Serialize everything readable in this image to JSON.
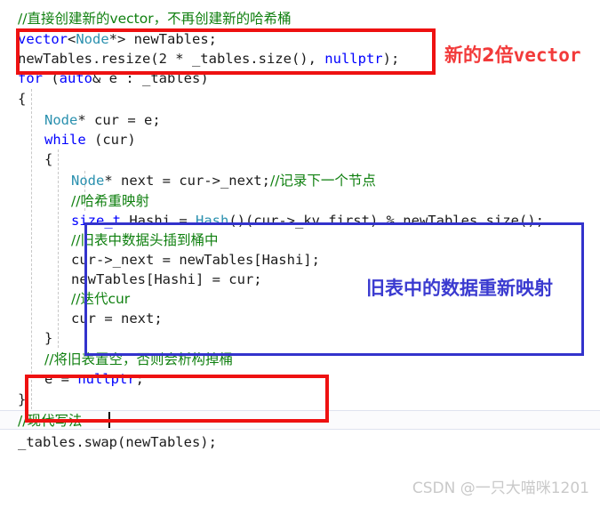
{
  "editor": {
    "language": "cpp",
    "background": "#ffffff",
    "colors": {
      "keyword": "#0000ff",
      "type": "#2b91af",
      "comment": "#108010",
      "plain": "#1b1b1b",
      "indent_guide": "#c8c8c8",
      "current_line_bg": "#fbfbfd"
    },
    "lines": [
      {
        "indent": 0,
        "tokens": [
          {
            "t": "//直接创建新的vector，不再创建新的哈希桶",
            "c": "cmt"
          }
        ]
      },
      {
        "indent": 0,
        "tokens": [
          {
            "t": "vector",
            "c": "kw"
          },
          {
            "t": "<",
            "c": "pln"
          },
          {
            "t": "Node",
            "c": "typ"
          },
          {
            "t": "*> newTables;",
            "c": "pln"
          }
        ]
      },
      {
        "indent": 0,
        "tokens": [
          {
            "t": "newTables.resize(2 * _tables.size(), ",
            "c": "pln"
          },
          {
            "t": "nullptr",
            "c": "kw"
          },
          {
            "t": ");",
            "c": "pln"
          }
        ]
      },
      {
        "indent": 0,
        "tokens": [
          {
            "t": "for",
            "c": "kw"
          },
          {
            "t": " (",
            "c": "pln"
          },
          {
            "t": "auto",
            "c": "kw"
          },
          {
            "t": "& e : _tables)",
            "c": "pln"
          }
        ]
      },
      {
        "indent": 0,
        "tokens": [
          {
            "t": "{",
            "c": "pln"
          }
        ]
      },
      {
        "indent": 1,
        "tokens": [
          {
            "t": "Node",
            "c": "typ"
          },
          {
            "t": "* cur = e;",
            "c": "pln"
          }
        ]
      },
      {
        "indent": 1,
        "tokens": [
          {
            "t": "while",
            "c": "kw"
          },
          {
            "t": " (cur)",
            "c": "pln"
          }
        ]
      },
      {
        "indent": 1,
        "tokens": [
          {
            "t": "{",
            "c": "pln"
          }
        ]
      },
      {
        "indent": 2,
        "tokens": [
          {
            "t": "Node",
            "c": "typ"
          },
          {
            "t": "* next = cur->_next;",
            "c": "pln"
          },
          {
            "t": "//记录下一个节点",
            "c": "cmt"
          }
        ]
      },
      {
        "indent": 2,
        "tokens": [
          {
            "t": "//哈希重映射",
            "c": "cmt"
          }
        ]
      },
      {
        "indent": 2,
        "tokens": [
          {
            "t": "size_t",
            "c": "kw"
          },
          {
            "t": " Hashi = ",
            "c": "pln"
          },
          {
            "t": "Hash",
            "c": "typ"
          },
          {
            "t": "()(cur->_kv.first) % newTables.size();",
            "c": "pln"
          }
        ]
      },
      {
        "indent": 2,
        "tokens": [
          {
            "t": "//旧表中数据头插到桶中",
            "c": "cmt"
          }
        ]
      },
      {
        "indent": 2,
        "tokens": [
          {
            "t": "cur->_next = newTables[Hashi];",
            "c": "pln"
          }
        ]
      },
      {
        "indent": 2,
        "tokens": [
          {
            "t": "newTables[Hashi] = cur;",
            "c": "pln"
          }
        ]
      },
      {
        "indent": 2,
        "tokens": [
          {
            "t": "//迭代cur",
            "c": "cmt"
          }
        ]
      },
      {
        "indent": 2,
        "tokens": [
          {
            "t": "cur = next;",
            "c": "pln"
          }
        ]
      },
      {
        "indent": 1,
        "tokens": [
          {
            "t": "}",
            "c": "pln"
          }
        ]
      },
      {
        "indent": 1,
        "tokens": [
          {
            "t": "//将旧表置空，否则会析构掉桶",
            "c": "cmt"
          }
        ]
      },
      {
        "indent": 1,
        "tokens": [
          {
            "t": "e = ",
            "c": "pln"
          },
          {
            "t": "nullptr",
            "c": "kw"
          },
          {
            "t": ";",
            "c": "pln"
          }
        ]
      },
      {
        "indent": 0,
        "tokens": [
          {
            "t": "}",
            "c": "pln"
          }
        ]
      },
      {
        "indent": 0,
        "tokens": [
          {
            "t": "//现代写法",
            "c": "cmt"
          }
        ]
      },
      {
        "indent": 0,
        "tokens": [
          {
            "t": "_tables.swap(newTables);",
            "c": "pln"
          }
        ]
      }
    ],
    "current_line_index": 20
  },
  "annotations": [
    {
      "id": "annotation-new-double-vector",
      "text": "新的2倍vector",
      "text_cjk": "新的2倍",
      "text_mono": "vector",
      "color": "#f23a3a",
      "kind": "red"
    },
    {
      "id": "annotation-remap-old-table",
      "text": "旧表中的数据重新映射",
      "color": "#3b3bd0",
      "kind": "blue"
    }
  ],
  "highlight_boxes": [
    {
      "id": "box-new-vector",
      "color": "#ee1111",
      "kind": "red"
    },
    {
      "id": "box-rehash",
      "color": "#3333cc",
      "kind": "blue"
    },
    {
      "id": "box-null-old-table",
      "color": "#ee1111",
      "kind": "red"
    }
  ],
  "watermark": {
    "text": "CSDN @一只大喵咪1201",
    "color": "#c9c9c9"
  }
}
